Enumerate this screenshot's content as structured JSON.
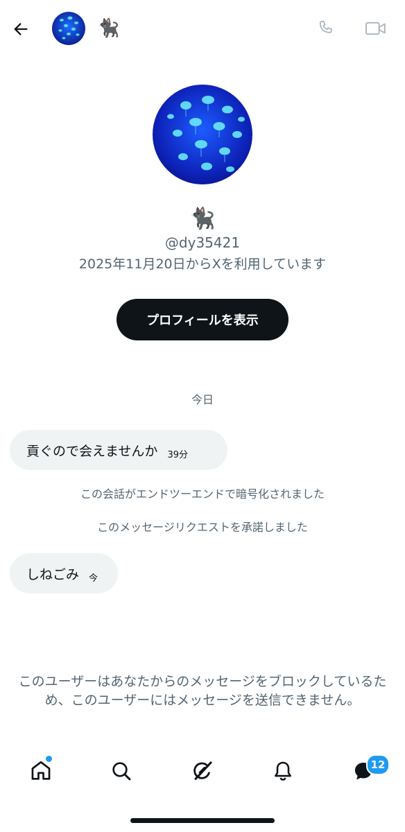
{
  "header": {
    "back_icon": "arrow-left-icon",
    "emoji": "🐈‍⬛",
    "phone_icon": "phone-icon",
    "video_icon": "video-icon"
  },
  "profile": {
    "emoji": "🐈‍⬛",
    "handle": "@dy35421",
    "joined": "2025年11月20日からXを利用しています",
    "view_profile_label": "プロフィールを表示"
  },
  "conversation": {
    "day_label": "今日",
    "messages": [
      {
        "text": "貢ぐので会えませんか",
        "time": "39分"
      },
      {
        "text": "しねごみ",
        "time": "今"
      }
    ],
    "system_notes": [
      "この会話がエンドツーエンドで暗号化されました",
      "このメッセージリクエストを承諾しました"
    ],
    "blocked_notice": "このユーザーはあなたからのメッセージをブロックしているため、このユーザーにはメッセージを送信できません。"
  },
  "tabbar": {
    "home_icon": "home-icon",
    "search_icon": "search-icon",
    "grok_icon": "grok-icon",
    "notifications_icon": "bell-icon",
    "messages_icon": "messages-icon",
    "messages_badge": "12"
  },
  "colors": {
    "accent": "#1d9bf0",
    "text": "#0f1419",
    "secondary": "#536471",
    "bubble": "#eff3f4"
  }
}
